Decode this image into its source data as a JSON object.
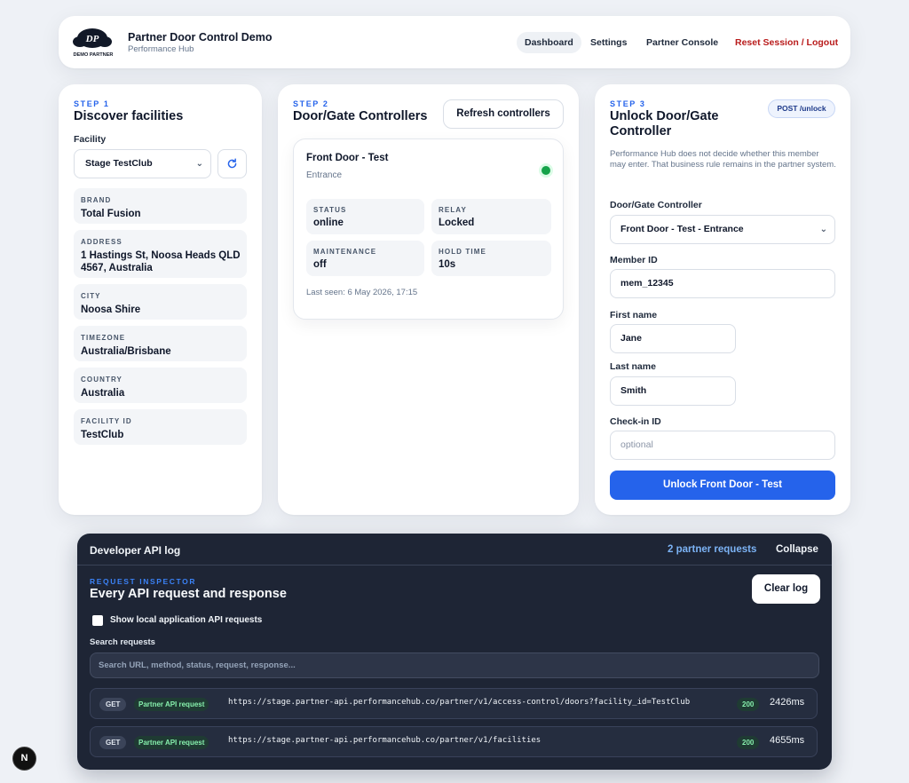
{
  "header": {
    "logo_text": "DP",
    "logo_caption": "DEMO PARTNER",
    "app_title": "Partner Door Control Demo",
    "app_subtitle": "Performance Hub",
    "nav": {
      "dashboard": "Dashboard",
      "settings": "Settings",
      "partner_console": "Partner Console",
      "reset": "Reset Session / Logout"
    }
  },
  "step1": {
    "step": "STEP 1",
    "title": "Discover facilities",
    "facility_label": "Facility",
    "facility_value": "Stage TestClub",
    "fields": [
      {
        "key": "BRAND",
        "value": "Total Fusion"
      },
      {
        "key": "ADDRESS",
        "value": "1 Hastings St, Noosa Heads QLD 4567, Australia"
      },
      {
        "key": "CITY",
        "value": "Noosa Shire"
      },
      {
        "key": "TIMEZONE",
        "value": "Australia/Brisbane"
      },
      {
        "key": "COUNTRY",
        "value": "Australia"
      },
      {
        "key": "FACILITY ID",
        "value": "TestClub"
      }
    ]
  },
  "step2": {
    "step": "STEP 2",
    "title": "Door/Gate Controllers",
    "refresh_label": "Refresh controllers",
    "controller": {
      "name": "Front Door - Test",
      "location": "Entrance",
      "status_color": "#16a34a",
      "status_key": "STATUS",
      "status": "online",
      "relay_key": "RELAY",
      "relay": "Locked",
      "maintenance_key": "MAINTENANCE",
      "maintenance": "off",
      "hold_key": "HOLD TIME",
      "hold": "10s",
      "last_seen": "Last seen: 6 May 2026, 17:15"
    }
  },
  "step3": {
    "step": "STEP 3",
    "title": "Unlock Door/Gate Controller",
    "badge": "POST /unlock",
    "disclaimer": "Performance Hub does not decide whether this member may enter. That business rule remains in the partner system.",
    "controller_label": "Door/Gate Controller",
    "controller_value": "Front Door - Test - Entrance",
    "member_label": "Member ID",
    "member_value": "mem_12345",
    "first_label": "First name",
    "first_value": "Jane",
    "last_label": "Last name",
    "last_value": "Smith",
    "checkin_label": "Check-in ID",
    "checkin_placeholder": "optional",
    "unlock_label": "Unlock Front Door - Test",
    "accent": "#2563eb"
  },
  "devlog": {
    "title": "Developer API log",
    "request_count": "2 partner requests",
    "collapse": "Collapse",
    "inspector_label": "REQUEST INSPECTOR",
    "inspector_title": "Every API request and response",
    "clear_label": "Clear log",
    "local_label": "Show local application API requests",
    "search_label": "Search requests",
    "search_placeholder": "Search URL, method, status, request, response...",
    "requests": [
      {
        "method": "GET",
        "kind": "Partner API request",
        "url": "https://stage.partner-api.performancehub.co/partner/v1/access-control/doors?facility_id=TestClub",
        "status": "200",
        "duration": "2426ms"
      },
      {
        "method": "GET",
        "kind": "Partner API request",
        "url": "https://stage.partner-api.performancehub.co/partner/v1/facilities",
        "status": "200",
        "duration": "4655ms"
      }
    ]
  },
  "next_badge": "N"
}
